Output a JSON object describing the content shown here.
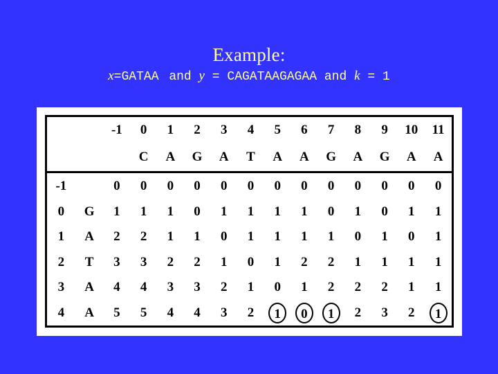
{
  "slide": {
    "background_color": "#3333ff",
    "text_color": "#ffff99",
    "title": "Example:",
    "subtitle": {
      "x_var": "x",
      "x_eq": "=",
      "x_value": "GATAA",
      "and_1": "and",
      "y_var": "y",
      "y_eq": "=",
      "y_value": "CAGATAAGAGAA",
      "and_2": "and",
      "k_var": "k",
      "k_eq": "=",
      "k_value": "1"
    }
  },
  "table": {
    "col_indices": [
      "-1",
      "0",
      "1",
      "2",
      "3",
      "4",
      "5",
      "6",
      "7",
      "8",
      "9",
      "10",
      "11"
    ],
    "col_chars": [
      "",
      "C",
      "A",
      "G",
      "A",
      "T",
      "A",
      "A",
      "G",
      "A",
      "G",
      "A",
      "A"
    ],
    "row_indices": [
      "-1",
      "0",
      "1",
      "2",
      "3",
      "4"
    ],
    "row_chars": [
      "",
      "G",
      "A",
      "T",
      "A",
      "A"
    ],
    "rows": [
      {
        "index": "-1",
        "char": "",
        "values": [
          "0",
          "0",
          "0",
          "0",
          "0",
          "0",
          "0",
          "0",
          "0",
          "0",
          "0",
          "0",
          "0"
        ],
        "circled": [
          false,
          false,
          false,
          false,
          false,
          false,
          false,
          false,
          false,
          false,
          false,
          false,
          false
        ]
      },
      {
        "index": "0",
        "char": "G",
        "values": [
          "1",
          "1",
          "1",
          "0",
          "1",
          "1",
          "1",
          "1",
          "0",
          "1",
          "0",
          "1",
          "1"
        ],
        "circled": [
          false,
          false,
          false,
          false,
          false,
          false,
          false,
          false,
          false,
          false,
          false,
          false,
          false
        ]
      },
      {
        "index": "1",
        "char": "A",
        "values": [
          "2",
          "2",
          "1",
          "1",
          "0",
          "1",
          "1",
          "1",
          "1",
          "0",
          "1",
          "0",
          "1"
        ],
        "circled": [
          false,
          false,
          false,
          false,
          false,
          false,
          false,
          false,
          false,
          false,
          false,
          false,
          false
        ]
      },
      {
        "index": "2",
        "char": "T",
        "values": [
          "3",
          "3",
          "2",
          "2",
          "1",
          "0",
          "1",
          "2",
          "2",
          "1",
          "1",
          "1",
          "1"
        ],
        "circled": [
          false,
          false,
          false,
          false,
          false,
          false,
          false,
          false,
          false,
          false,
          false,
          false,
          false
        ]
      },
      {
        "index": "3",
        "char": "A",
        "values": [
          "4",
          "4",
          "3",
          "3",
          "2",
          "1",
          "0",
          "1",
          "2",
          "2",
          "2",
          "1",
          "1"
        ],
        "circled": [
          false,
          false,
          false,
          false,
          false,
          false,
          false,
          false,
          false,
          false,
          false,
          false,
          false
        ]
      },
      {
        "index": "4",
        "char": "A",
        "values": [
          "5",
          "5",
          "4",
          "4",
          "3",
          "2",
          "1",
          "0",
          "1",
          "2",
          "3",
          "2",
          "1"
        ],
        "circled": [
          false,
          false,
          false,
          false,
          false,
          false,
          true,
          true,
          true,
          false,
          false,
          false,
          true
        ]
      }
    ]
  }
}
